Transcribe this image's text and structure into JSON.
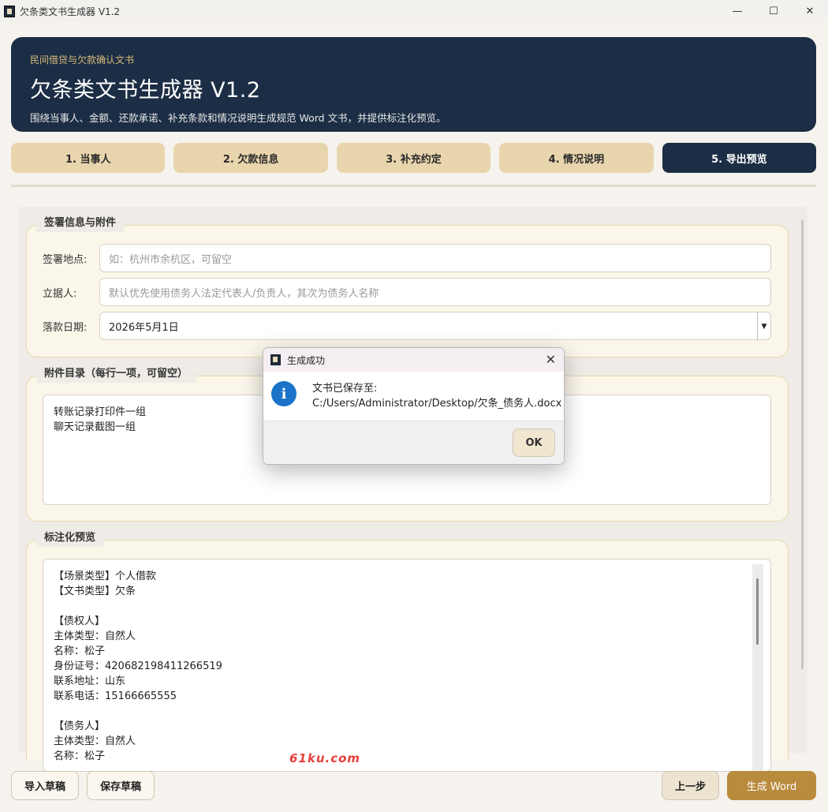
{
  "window": {
    "title": "欠条类文书生成器 V1.2",
    "minimize": "—",
    "maximize": "☐",
    "close": "✕"
  },
  "banner": {
    "kicker": "民间借贷与欠款确认文书",
    "title": "欠条类文书生成器 V1.2",
    "desc": "围绕当事人、金额、还款承诺、补充条款和情况说明生成规范 Word 文书，并提供标注化预览。"
  },
  "tabs": [
    {
      "label": "1. 当事人",
      "active": false
    },
    {
      "label": "2. 欠款信息",
      "active": false
    },
    {
      "label": "3. 补充约定",
      "active": false
    },
    {
      "label": "4. 情况说明",
      "active": false
    },
    {
      "label": "5. 导出预览",
      "active": true
    }
  ],
  "signing": {
    "title": "签署信息与附件",
    "place_label": "签署地点:",
    "place_placeholder": "如：杭州市余杭区，可留空",
    "signer_label": "立据人:",
    "signer_placeholder": "默认优先使用债务人法定代表人/负责人，其次为债务人名称",
    "date_label": "落款日期:",
    "date_value": "2026年5月1日",
    "date_arrow": "▼"
  },
  "attachments": {
    "title": "附件目录（每行一项，可留空）",
    "content": "转账记录打印件一组\n聊天记录截图一组"
  },
  "preview": {
    "title": "标注化预览",
    "lines": [
      "【场景类型】个人借款",
      "【文书类型】欠条",
      "",
      "【债权人】",
      "主体类型：自然人",
      "名称：松子",
      "身份证号：420682198411266519",
      "联系地址：山东",
      "联系电话：15166665555",
      "",
      "【债务人】",
      "主体类型：自然人",
      "名称：松子"
    ]
  },
  "buttons": {
    "import": "导入草稿",
    "save": "保存草稿",
    "prev": "上一步",
    "generate": "生成 Word"
  },
  "watermark": "61ku.com",
  "dialog": {
    "title": "生成成功",
    "close": "✕",
    "icon": "i",
    "message_line1": "文书已保存至:",
    "message_line2": "C:/Users/Administrator/Desktop/欠条_债务人.docx",
    "ok": "OK"
  }
}
